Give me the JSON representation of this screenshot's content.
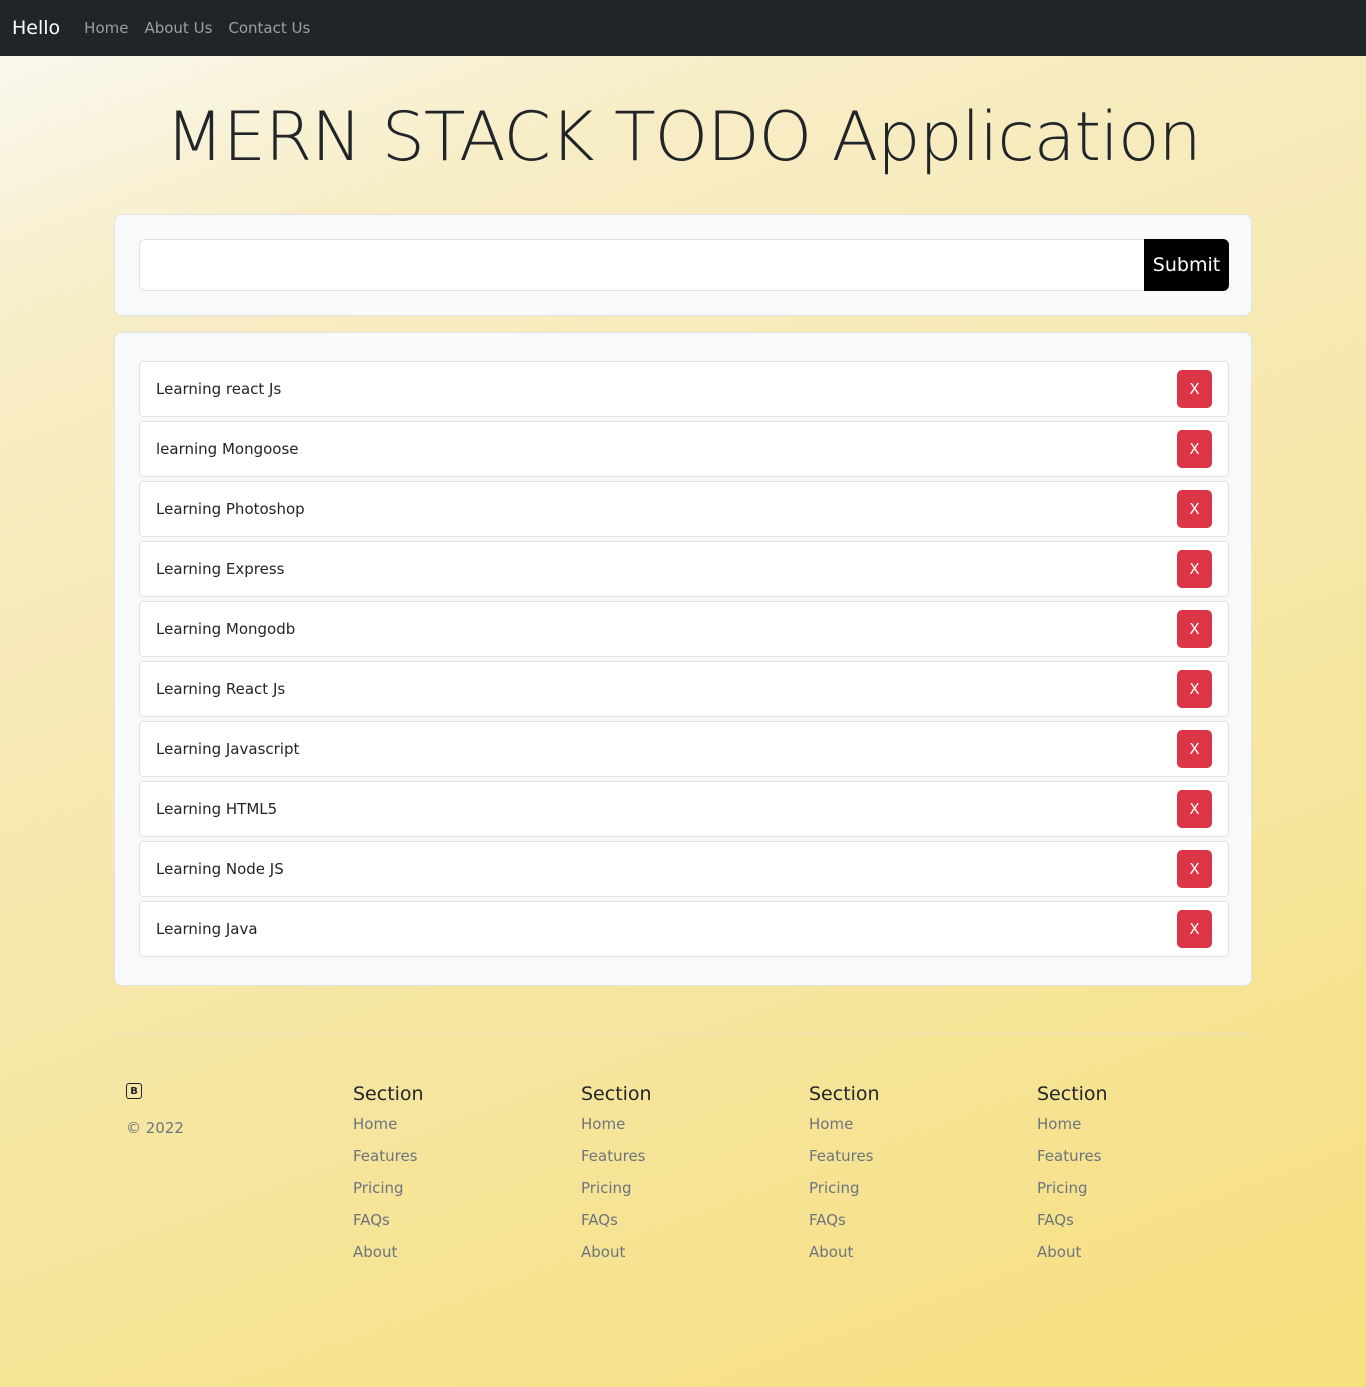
{
  "navbar": {
    "brand": "Hello",
    "links": [
      "Home",
      "About Us",
      "Contact Us"
    ]
  },
  "title": "MERN STACK TODO Application",
  "form": {
    "input_value": "",
    "submit_label": "Submit"
  },
  "todos": [
    "Learning react Js",
    "learning Mongoose",
    "Learning Photoshop",
    "Learning Express",
    "Learning Mongodb",
    "Learning React Js",
    "Learning Javascript",
    "Learning HTML5",
    "Learning Node JS",
    "Learning Java"
  ],
  "delete_label": "X",
  "footer": {
    "logo_letter": "B",
    "copyright": "© 2022",
    "columns": [
      {
        "heading": "Section",
        "links": [
          "Home",
          "Features",
          "Pricing",
          "FAQs",
          "About"
        ]
      },
      {
        "heading": "Section",
        "links": [
          "Home",
          "Features",
          "Pricing",
          "FAQs",
          "About"
        ]
      },
      {
        "heading": "Section",
        "links": [
          "Home",
          "Features",
          "Pricing",
          "FAQs",
          "About"
        ]
      },
      {
        "heading": "Section",
        "links": [
          "Home",
          "Features",
          "Pricing",
          "FAQs",
          "About"
        ]
      }
    ]
  },
  "colors": {
    "navbar_bg": "#212529",
    "delete_button": "#dc3545",
    "submit_button": "#000000"
  }
}
